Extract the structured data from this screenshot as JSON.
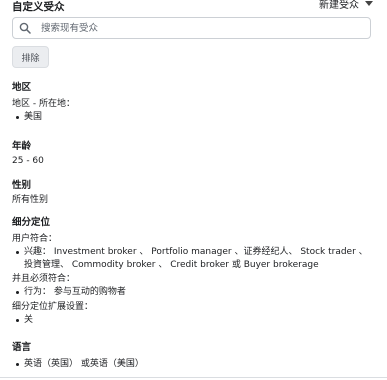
{
  "header": {
    "title": "自定义受众",
    "new_audience_label": "新建受众"
  },
  "search": {
    "placeholder": "搜索现有受众",
    "value": ""
  },
  "exclude_button": "排除",
  "location": {
    "heading": "地区",
    "label": "地区 - 所在地：",
    "items": [
      "美国"
    ]
  },
  "age": {
    "heading": "年龄",
    "value": "25 - 60"
  },
  "gender": {
    "heading": "性别",
    "value": "所有性别"
  },
  "targeting": {
    "heading": "细分定位",
    "match_label": "用户符合：",
    "interests_line1": "兴趣： Investment broker 、 Portfolio manager 、证券经纪人、 Stock trader 、",
    "interests_line2": "投資管理、 Commodity broker 、 Credit broker 或 Buyer brokerage",
    "and_label": "并且必须符合：",
    "behavior": "行为： 参与互动的购物者",
    "expansion_label": "细分定位扩展设置：",
    "expansion_value": "关"
  },
  "language": {
    "heading": "语言",
    "items": [
      "英语（英国） 或英语（美国）"
    ]
  },
  "icons": {
    "search": "search-icon",
    "dropdown": "caret-down-icon"
  }
}
